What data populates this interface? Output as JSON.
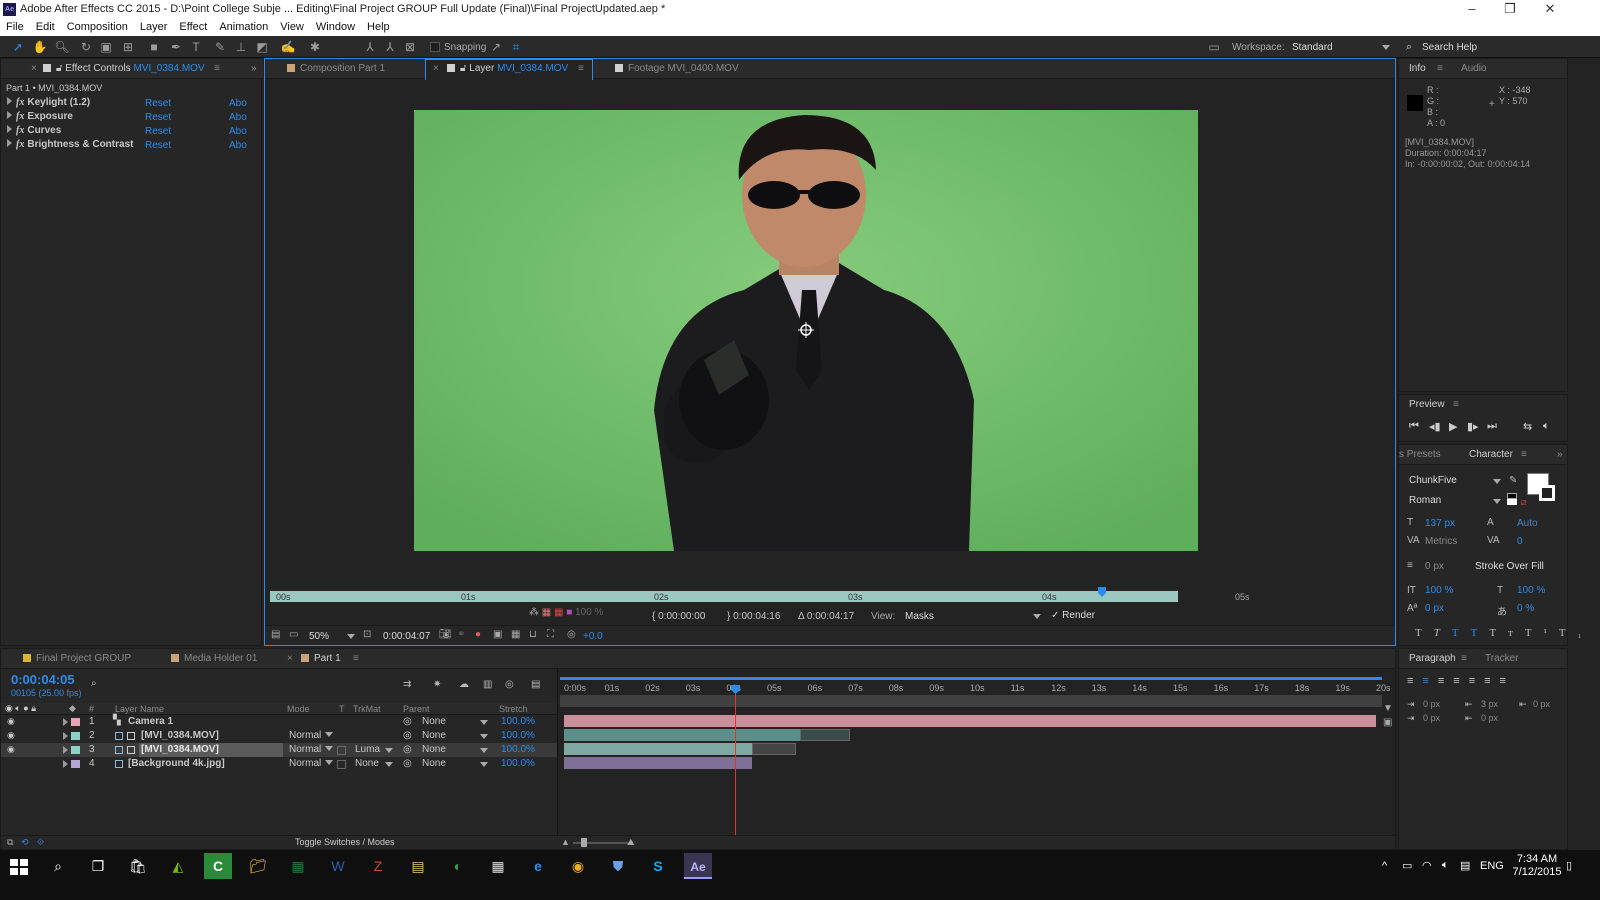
{
  "window": {
    "title": "Adobe After Effects CC 2015 - D:\\Point College Subje ... Editing\\Final Project GROUP Full Update (Final)\\Final ProjectUpdated.aep *",
    "app_badge": "Ae"
  },
  "menu": [
    "File",
    "Edit",
    "Composition",
    "Layer",
    "Effect",
    "Animation",
    "View",
    "Window",
    "Help"
  ],
  "toolbar": {
    "snapping_label": "Snapping",
    "workspace_label": "Workspace:",
    "workspace_value": "Standard",
    "search_help": "Search Help"
  },
  "effect_controls": {
    "tab_label": "Effect Controls",
    "tab_file": "MVI_0384.MOV",
    "breadcrumb": "Part 1 • MVI_0384.MOV",
    "effects": [
      {
        "name": "Keylight (1.2)",
        "reset": "Reset",
        "about": "Abo"
      },
      {
        "name": "Exposure",
        "reset": "Reset",
        "about": "Abo"
      },
      {
        "name": "Curves",
        "reset": "Reset",
        "about": "Abo"
      },
      {
        "name": "Brightness & Contrast",
        "reset": "Reset",
        "about": "Abo"
      }
    ]
  },
  "viewer_tabs": [
    {
      "label": "Composition",
      "file": "Part 1"
    },
    {
      "label": "Layer",
      "file": "MVI_0384.MOV"
    },
    {
      "label": "Footage",
      "file": "MVI_0400.MOV"
    }
  ],
  "layer_ruler": [
    "00s",
    "01s",
    "02s",
    "03s",
    "04s",
    "05s"
  ],
  "layer_controls": {
    "exposure_pct": "100 %",
    "in_time": "0:00:00:00",
    "out_time": "0:00:04:16",
    "duration": "Δ 0:00:04:17",
    "view_label": "View:",
    "view_value": "Masks",
    "render_label": "Render"
  },
  "viewer_footer": {
    "zoom": "50%",
    "timecode": "0:00:04:07",
    "exposure_value": "+0.0"
  },
  "info": {
    "tab_info": "Info",
    "tab_audio": "Audio",
    "r": "R :",
    "g": "G :",
    "b": "B :",
    "a": "A : 0",
    "x": "X : -348",
    "y": "Y : 570",
    "file": "[MVI_0384.MOV]",
    "duration": "Duration: 0:00:04:17",
    "inout": "In: -0:00:00:02, Out: 0:00:04:14"
  },
  "preview": {
    "tab": "Preview"
  },
  "character": {
    "tab_presets": "s Presets",
    "tab_character": "Character",
    "font": "ChunkFive",
    "style": "Roman",
    "size": "137 px",
    "leading": "Auto",
    "kerning": "Metrics",
    "tracking": "0",
    "stroke_width": "0 px",
    "stroke_type": "Stroke Over Fill",
    "vscale": "100 %",
    "hscale": "100 %",
    "baseline": "0 px",
    "tsume": "0 %"
  },
  "paragraph": {
    "tab_paragraph": "Paragraph",
    "tab_tracker": "Tracker",
    "indent_left": "0 px",
    "indent_before": "3 px",
    "indent_right": "0 px",
    "space_before": "0 px",
    "space_after": "0 px"
  },
  "timeline": {
    "tabs": [
      {
        "label": "Final Project GROUP",
        "color": "#d9b82f"
      },
      {
        "label": "Media Holder 01",
        "color": "#c9a27a"
      },
      {
        "label": "Part 1",
        "color": "#c9a27a"
      }
    ],
    "timecode": "0:00:04:05",
    "frames": "00105 (25.00 fps)",
    "columns": {
      "num": "#",
      "name": "Layer Name",
      "mode": "Mode",
      "t": "T",
      "trkmat": "TrkMat",
      "parent": "Parent",
      "stretch": "Stretch"
    },
    "layers": [
      {
        "num": "1",
        "name": "Camera 1",
        "mode": "",
        "trkmat": "",
        "parent": "None",
        "stretch": "100.0%",
        "color": "#e8a3b4"
      },
      {
        "num": "2",
        "name": "[MVI_0384.MOV]",
        "mode": "Normal",
        "trkmat": "",
        "parent": "None",
        "stretch": "100.0%",
        "color": "#8fd1c6"
      },
      {
        "num": "3",
        "name": "[MVI_0384.MOV]",
        "mode": "Normal",
        "trkmat": "Luma",
        "parent": "None",
        "stretch": "100.0%",
        "color": "#8fd1c6"
      },
      {
        "num": "4",
        "name": "[Background 4k.jpg]",
        "mode": "Normal",
        "trkmat": "None",
        "parent": "None",
        "stretch": "100.0%",
        "color": "#b5a4d6"
      }
    ],
    "ruler": [
      "0:00s",
      "01s",
      "02s",
      "03s",
      "04s",
      "05s",
      "06s",
      "07s",
      "08s",
      "09s",
      "10s",
      "11s",
      "12s",
      "13s",
      "14s",
      "15s",
      "16s",
      "17s",
      "18s",
      "19s",
      "20s"
    ],
    "toggle_label": "Toggle Switches / Modes"
  },
  "taskbar": {
    "lang": "ENG",
    "time": "7:34 AM",
    "date": "7/12/2015",
    "ae_badge": "Ae"
  }
}
